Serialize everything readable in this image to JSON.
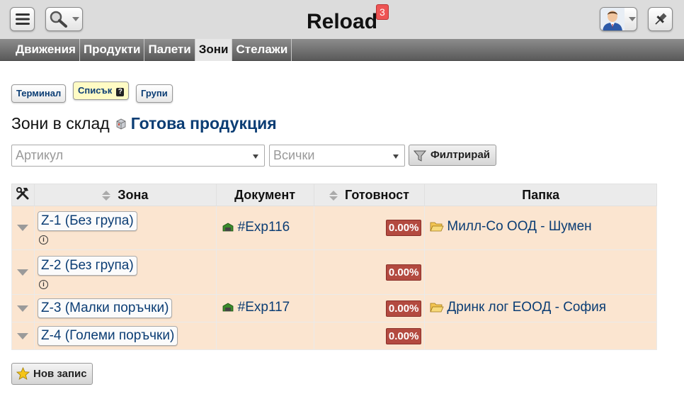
{
  "header": {
    "title": "Reload",
    "notification_count": "3",
    "icons": {
      "menu": "hamburger-menu-icon",
      "search": "search-icon",
      "avatar": "user-avatar",
      "pin": "pin-icon"
    }
  },
  "tabs": [
    {
      "label": "Движения",
      "active": false
    },
    {
      "label": "Продукти",
      "active": false
    },
    {
      "label": "Палети",
      "active": false
    },
    {
      "label": "Зони",
      "active": true
    },
    {
      "label": "Стелажи",
      "active": false
    }
  ],
  "modes": {
    "terminal": "Терминал",
    "list": "Списък",
    "groups": "Групи",
    "help_mark": "?"
  },
  "heading": {
    "prefix": "Зони в склад",
    "store": "Готова продукция"
  },
  "filters": {
    "article_placeholder": "Артикул",
    "state_selected": "Всички",
    "filter_button": "Филтрирай"
  },
  "table": {
    "columns": [
      "Зона",
      "Документ",
      "Готовност",
      "Папка"
    ],
    "rows": [
      {
        "zone": "Z-1 (Без група)",
        "document": "#Exp116",
        "readiness": "0.00%",
        "folder": "Милл-Со ООД - Шумен",
        "info": true
      },
      {
        "zone": "Z-2 (Без група)",
        "document": "",
        "readiness": "0.00%",
        "folder": "",
        "info": true
      },
      {
        "zone": "Z-3 (Малки поръчки)",
        "document": "#Exp117",
        "readiness": "0.00%",
        "folder": "Дринк лог ЕООД - София",
        "info": false
      },
      {
        "zone": "Z-4 (Големи поръчки)",
        "document": "",
        "readiness": "0.00%",
        "folder": "",
        "info": false
      }
    ]
  },
  "footer": {
    "new_record": "Нов запис"
  },
  "colors": {
    "link": "#0b3d74",
    "row_bg": "#fbe5d0",
    "percent_badge": "#b34a40",
    "badge": "#ee5555"
  }
}
